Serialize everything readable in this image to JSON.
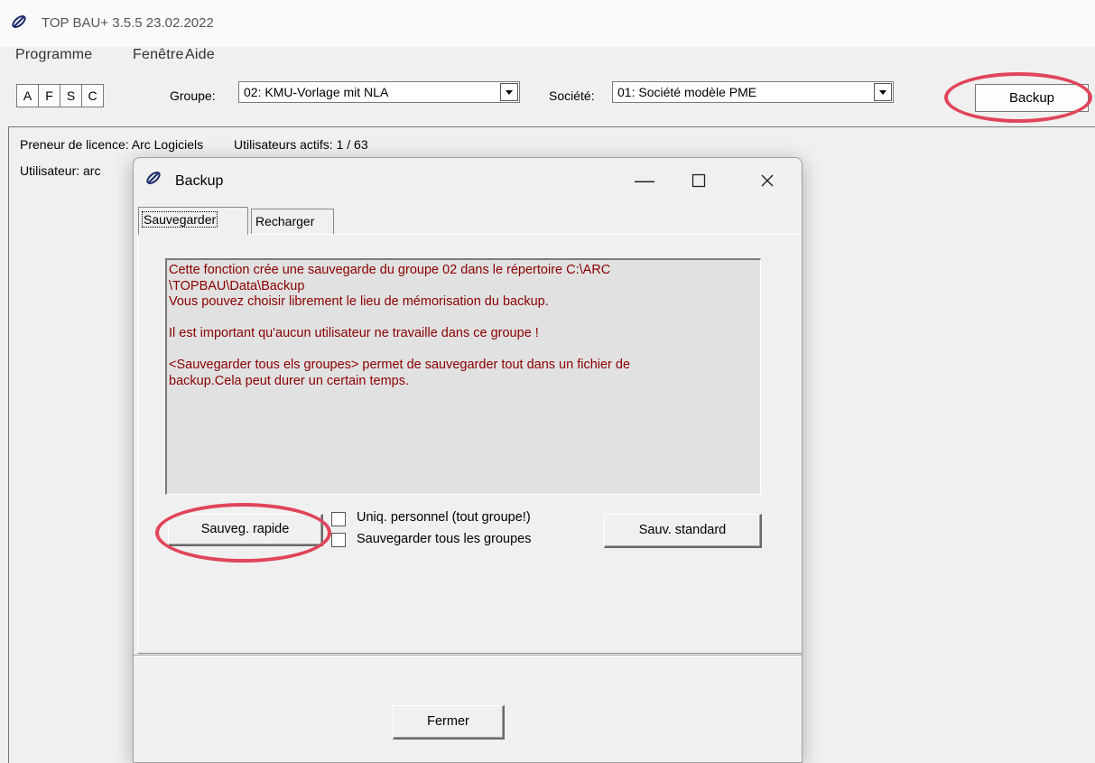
{
  "app": {
    "title": "TOP BAU+ 3.5.5  23.02.2022"
  },
  "menu": {
    "items": [
      "Programme",
      "Fenêtre",
      "Aide"
    ]
  },
  "toolbar": {
    "buttons": [
      "A",
      "F",
      "S",
      "C"
    ],
    "group_label": "Groupe:",
    "group_value": "02: KMU-Vorlage mit NLA",
    "company_label": "Société:",
    "company_value": "01: Société modèle PME",
    "backup_label": "Backup"
  },
  "status": {
    "licensee": "Preneur de licence: Arc Logiciels",
    "active_users": "Utilisateurs actifs: 1 / 63",
    "user": "Utilisateur: arc"
  },
  "dialog": {
    "title": "Backup",
    "tabs": [
      "Sauvegarder",
      "Recharger"
    ],
    "active_tab": "Sauvegarder",
    "info_lines": [
      "Cette fonction crée une sauvegarde du groupe 02 dans le répertoire C:\\ARC",
      "\\TOPBAU\\Data\\Backup",
      "Vous pouvez choisir librement le lieu de mémorisation du backup.",
      "",
      "Il est important qu'aucun utilisateur ne travaille dans ce groupe !",
      "",
      "<Sauvegarder tous els groupes> permet de sauvegarder tout dans un fichier de",
      "backup.Cela peut durer un certain temps."
    ],
    "quick_backup_label": "Sauveg. rapide",
    "checkbox_personnel_label": "Uniq. personnel (tout groupe!)",
    "checkbox_personnel_checked": false,
    "checkbox_all_groups_label": "Sauvegarder tous les groupes",
    "checkbox_all_groups_checked": false,
    "standard_backup_label": "Sauv. standard",
    "close_label": "Fermer"
  },
  "annotations": {
    "highlight_color": "#e0455a"
  }
}
